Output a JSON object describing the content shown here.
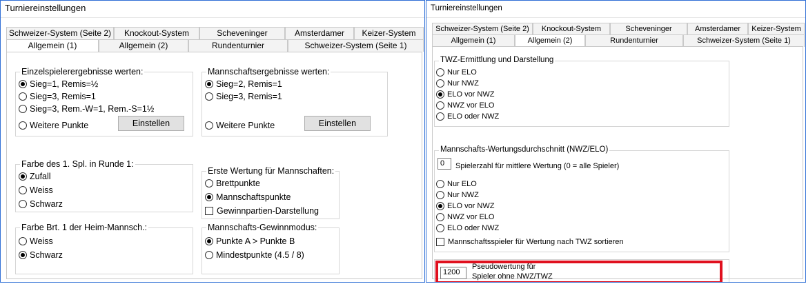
{
  "left": {
    "title": "Turniereinstellungen",
    "tabs_back": [
      "Schweizer-System (Seite 2)",
      "Knockout-System",
      "Scheveninger",
      "Amsterdamer",
      "Keizer-System"
    ],
    "tabs_front": [
      "Allgemein (1)",
      "Allgemein (2)",
      "Rundenturnier",
      "Schweizer-System (Seite 1)"
    ],
    "einzel": {
      "legend": "Einzelspielerergebnisse werten:",
      "options": [
        "Sieg=1, Remis=½",
        "Sieg=3, Remis=1",
        "Sieg=3, Rem.-W=1, Rem.-S=1½"
      ],
      "weitere": "Weitere Punkte",
      "button": "Einstellen"
    },
    "mannschaft": {
      "legend": "Mannschaftsergebnisse werten:",
      "options": [
        "Sieg=2, Remis=1",
        "Sieg=3, Remis=1"
      ],
      "weitere": "Weitere Punkte",
      "button": "Einstellen"
    },
    "farbe": {
      "legend": "Farbe des 1. Spl. in Runde 1:",
      "options": [
        "Zufall",
        "Weiss",
        "Schwarz"
      ]
    },
    "wertung": {
      "legend": "Erste Wertung für Mannschaften:",
      "options": [
        "Brettpunkte",
        "Mannschaftspunkte"
      ],
      "checkbox": "Gewinnpartien-Darstellung"
    },
    "heim": {
      "legend": "Farbe Brt. 1 der Heim-Mannsch.:",
      "options": [
        "Weiss",
        "Schwarz"
      ]
    },
    "gewinn": {
      "legend": "Mannschafts-Gewinnmodus:",
      "options": [
        "Punkte A > Punkte B",
        "Mindestpunkte (4.5 / 8)"
      ]
    }
  },
  "right": {
    "title": "Turniereinstellungen",
    "tabs_back": [
      "Schweizer-System (Seite 2)",
      "Knockout-System",
      "Scheveninger",
      "Amsterdamer",
      "Keizer-System"
    ],
    "tabs_front": [
      "Allgemein (1)",
      "Allgemein (2)",
      "Rundenturnier",
      "Schweizer-System (Seite 1)"
    ],
    "twz": {
      "legend": "TWZ-Ermittlung und Darstellung",
      "options": [
        "Nur ELO",
        "Nur NWZ",
        "ELO vor NWZ",
        "NWZ vor ELO",
        "ELO oder NWZ"
      ]
    },
    "mwd": {
      "legend": "Mannschafts-Wertungsdurchschnitt (NWZ/ELO)",
      "count_value": "0",
      "count_label": "Spielerzahl für mittlere Wertung (0 = alle Spieler)",
      "options": [
        "Nur ELO",
        "Nur NWZ",
        "ELO vor NWZ",
        "NWZ vor ELO",
        "ELO oder NWZ"
      ],
      "checkbox": "Mannschaftsspieler für Wertung nach TWZ sortieren"
    },
    "pseudo": {
      "value": "1200",
      "label_line1": "Pseudowertung für",
      "label_line2": "Spieler ohne NWZ/TWZ"
    }
  },
  "colors": {
    "window_border": "#2f6fd6",
    "highlight": "#e0101e"
  }
}
